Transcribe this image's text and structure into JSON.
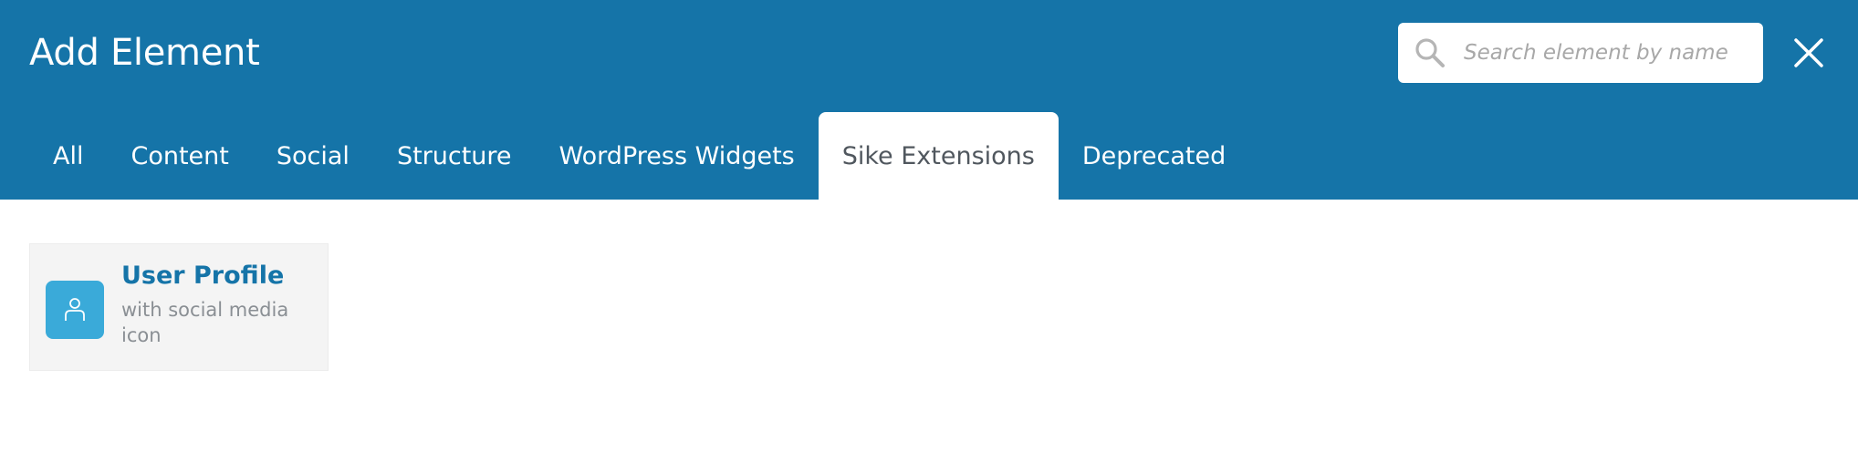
{
  "dialog": {
    "title": "Add Element"
  },
  "search": {
    "placeholder": "Search element by name",
    "value": ""
  },
  "tabs": [
    {
      "label": "All",
      "active": false
    },
    {
      "label": "Content",
      "active": false
    },
    {
      "label": "Social",
      "active": false
    },
    {
      "label": "Structure",
      "active": false
    },
    {
      "label": "WordPress Widgets",
      "active": false
    },
    {
      "label": "Sike Extensions",
      "active": true
    },
    {
      "label": "Deprecated",
      "active": false
    }
  ],
  "elements": [
    {
      "title": "User Profile",
      "description": "with social media icon",
      "icon": "user-icon"
    }
  ],
  "colors": {
    "header_bg": "#1574a8",
    "icon_bg": "#3aaad9",
    "title_accent": "#1574a8"
  },
  "icons": {
    "search": "search-icon",
    "close": "close-icon"
  }
}
